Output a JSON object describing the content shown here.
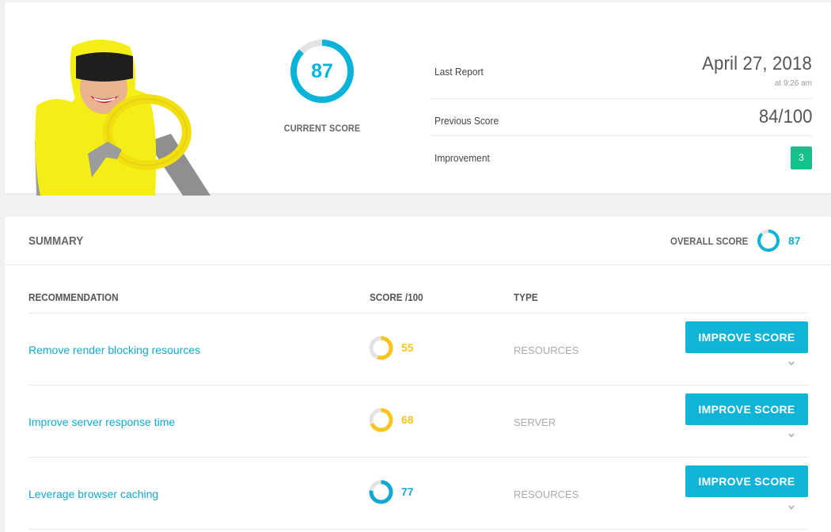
{
  "current": {
    "score": "87",
    "score_fraction": 0.87,
    "caption": "CURRENT SCORE",
    "color": "#0ab4d8"
  },
  "report": {
    "last_report_label": "Last Report",
    "last_report_date": "April 27, 2018",
    "last_report_time": "at 9:26 am",
    "previous_label": "Previous Score",
    "previous_value": "84/100",
    "improvement_label": "Improvement",
    "improvement_value": "3",
    "improvement_color": "#16c08a"
  },
  "summary": {
    "title": "SUMMARY",
    "overall_label": "OVERALL SCORE",
    "overall_score": "87",
    "overall_fraction": 0.87
  },
  "table": {
    "headers": {
      "recommendation": "RECOMMENDATION",
      "score": "SCORE /100",
      "type": "TYPE"
    },
    "rows": [
      {
        "recommendation": "Remove render blocking resources",
        "score": "55",
        "fraction": 0.55,
        "color": "#f7c51e",
        "type": "RESOURCES",
        "button": "IMPROVE SCORE"
      },
      {
        "recommendation": "Improve server response time",
        "score": "68",
        "fraction": 0.68,
        "color": "#f7c51e",
        "type": "SERVER",
        "button": "IMPROVE SCORE"
      },
      {
        "recommendation": "Leverage browser caching",
        "score": "77",
        "fraction": 0.77,
        "color": "#11a9cf",
        "type": "RESOURCES",
        "button": "IMPROVE SCORE"
      }
    ]
  }
}
